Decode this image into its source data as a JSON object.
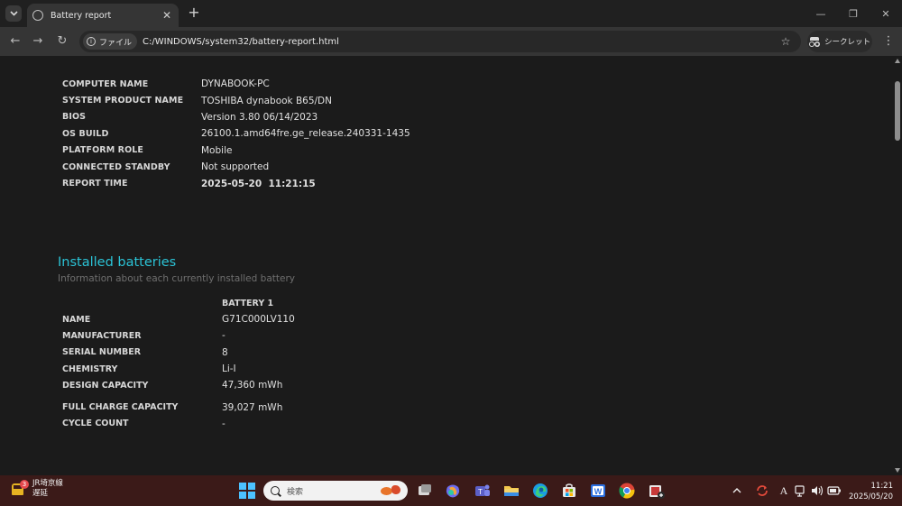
{
  "browser": {
    "tab_title": "Battery report",
    "new_tab": "+",
    "chip_label": "ファイル",
    "url": "C:/WINDOWS/system32/battery-report.html",
    "incognito_label": "シークレット",
    "icons": [
      "tab-list-icon",
      "globe-icon",
      "close-icon",
      "minimize-icon",
      "restore-icon",
      "window-close-icon",
      "back-icon",
      "forward-icon",
      "reload-icon",
      "info-icon",
      "star-icon",
      "incognito-icon",
      "more-icon"
    ]
  },
  "system_info": [
    {
      "label": "COMPUTER NAME",
      "value": "DYNABOOK-PC"
    },
    {
      "label": "SYSTEM PRODUCT NAME",
      "value": "TOSHIBA dynabook B65/DN"
    },
    {
      "label": "BIOS",
      "value": "Version 3.80 06/14/2023"
    },
    {
      "label": "OS BUILD",
      "value": "26100.1.amd64fre.ge_release.240331-1435"
    },
    {
      "label": "PLATFORM ROLE",
      "value": "Mobile"
    },
    {
      "label": "CONNECTED STANDBY",
      "value": "Not supported"
    },
    {
      "label": "REPORT TIME",
      "value": "2025-05-20  11:21:15"
    }
  ],
  "installed_batteries": {
    "title": "Installed batteries",
    "subtitle": "Information about each currently installed battery",
    "column_header": "BATTERY 1",
    "rows": [
      {
        "label": "NAME",
        "value": "G71C000LV110"
      },
      {
        "label": "MANUFACTURER",
        "value": "-"
      },
      {
        "label": "SERIAL NUMBER",
        "value": "8"
      },
      {
        "label": "CHEMISTRY",
        "value": "Li-I"
      },
      {
        "label": "DESIGN CAPACITY",
        "value": "47,360 mWh"
      },
      {
        "label": "FULL CHARGE CAPACITY",
        "value": "39,027 mWh"
      },
      {
        "label": "CYCLE COUNT",
        "value": "-"
      }
    ]
  },
  "taskbar": {
    "weather_badge": "3",
    "weather_line1": "JR埼京線",
    "weather_line2": "遅延",
    "search_placeholder": "検索",
    "tray_ime": "A",
    "time": "11:21",
    "date": "2025/05/20",
    "colors": {
      "taskbar_bg": "#3b1a18",
      "accent": "#2bc3d6"
    }
  }
}
